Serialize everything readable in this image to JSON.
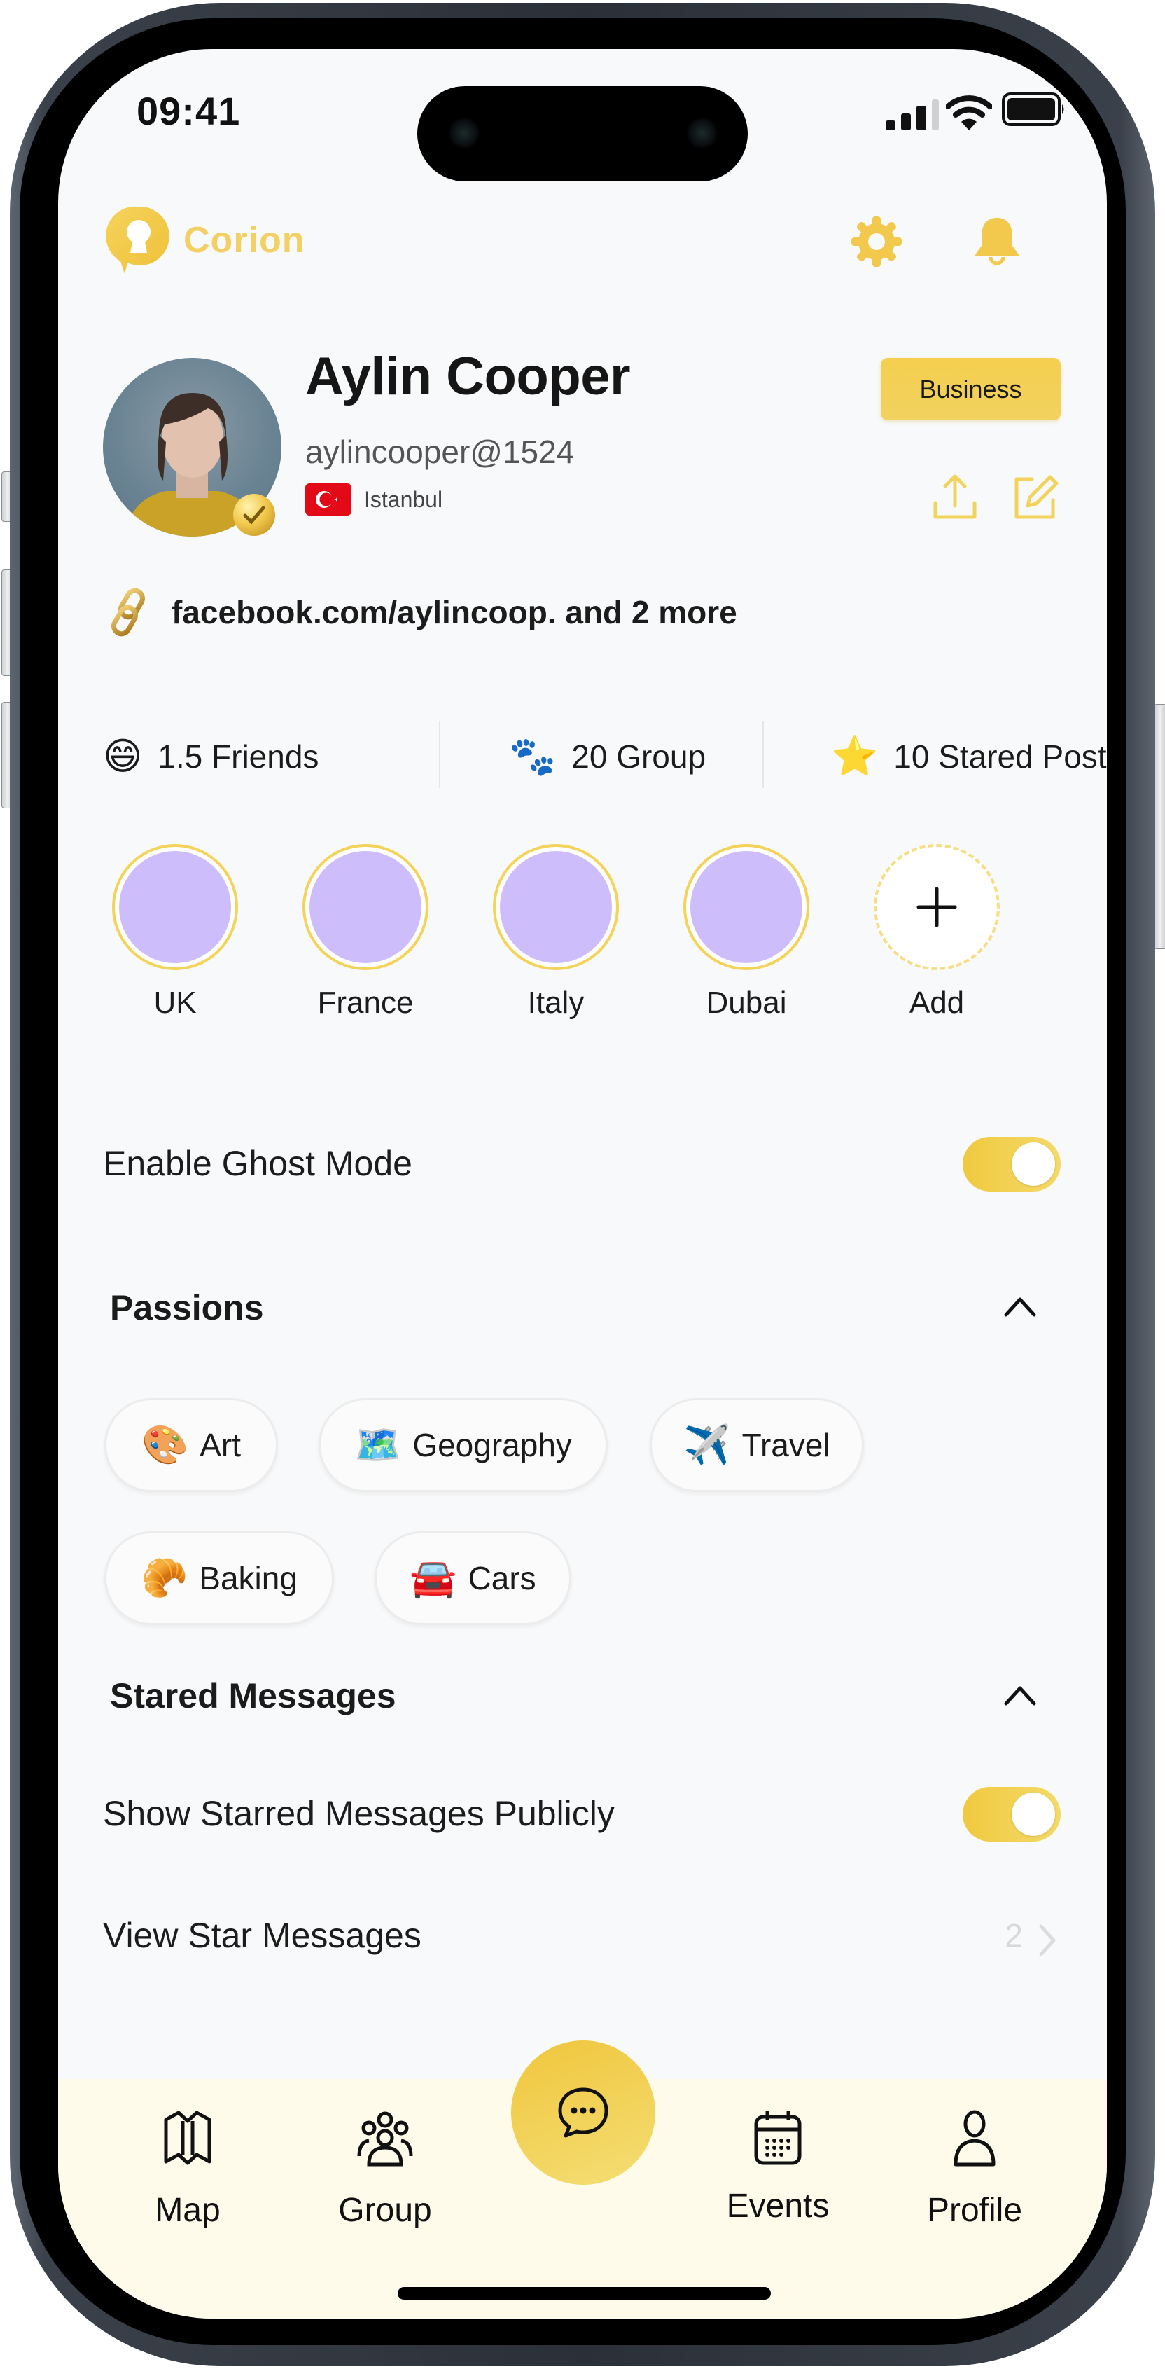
{
  "status_bar": {
    "time": "09:41",
    "signal_bars_filled": 3,
    "signal_bars_total": 4,
    "battery_level": 1.0
  },
  "header": {
    "app_name": "Corion",
    "icons": {
      "settings": "gear-icon",
      "notifications": "bell-icon"
    }
  },
  "profile": {
    "name": "Aylin Cooper",
    "handle": "aylincooper@1524",
    "location": "Istanbul",
    "country_flag": "turkey-flag",
    "verified": true,
    "account_type_button": "Business",
    "actions": {
      "share": "share-icon",
      "edit": "edit-icon"
    },
    "link_text": "facebook.com/aylincoop. and 2 more"
  },
  "stats": [
    {
      "icon": "grinning-face",
      "emoji": "😄",
      "label": "1.5 Friends"
    },
    {
      "icon": "group-paws",
      "emoji": "🐾",
      "label": "20 Group"
    },
    {
      "icon": "star",
      "emoji": "⭐",
      "label": "10 Stared Post"
    }
  ],
  "stories": [
    {
      "label": "UK"
    },
    {
      "label": "France"
    },
    {
      "label": "Italy"
    },
    {
      "label": "Dubai"
    },
    {
      "label": "Add",
      "is_add": true
    }
  ],
  "ghost_mode": {
    "label": "Enable Ghost Mode",
    "enabled": true
  },
  "passions": {
    "title": "Passions",
    "expanded": true,
    "items": [
      {
        "emoji": "🎨",
        "label": "Art"
      },
      {
        "emoji": "🗺️",
        "label": "Geography"
      },
      {
        "emoji": "✈️",
        "label": "Travel"
      },
      {
        "emoji": "🥐",
        "label": "Baking"
      },
      {
        "emoji": "🚘",
        "label": "Cars"
      }
    ]
  },
  "starred": {
    "title": "Stared Messages",
    "expanded": true,
    "show_publicly_label": "Show Starred Messages Publicly",
    "show_publicly_enabled": true,
    "view_label": "View Star Messages",
    "view_count": "2"
  },
  "nav": {
    "items": [
      {
        "label": "Map",
        "icon": "map-icon"
      },
      {
        "label": "Group",
        "icon": "group-icon"
      },
      {
        "label": "",
        "icon": "chat-icon",
        "center": true
      },
      {
        "label": "Events",
        "icon": "calendar-icon"
      },
      {
        "label": "Profile",
        "icon": "profile-icon"
      }
    ]
  },
  "colors": {
    "accent": "#f2c94c",
    "story_fill": "#cdbdfa",
    "nav_background": "#fefbeb",
    "screen_background": "#f8f9fa",
    "flag_red": "#e30a17"
  }
}
